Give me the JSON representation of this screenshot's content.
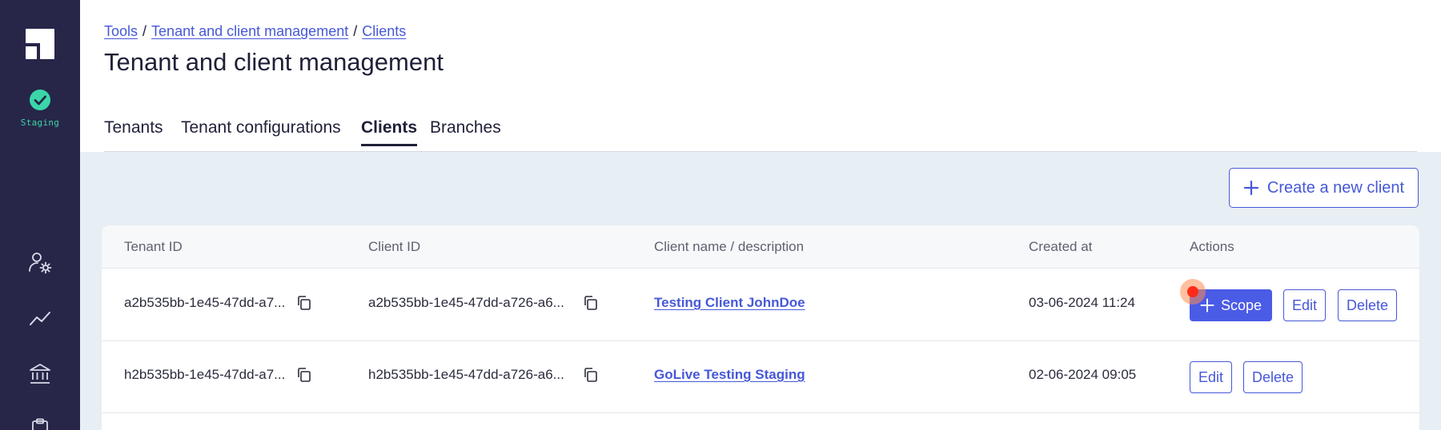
{
  "sidebar": {
    "environment_label": "Staging",
    "icons": [
      "logo-icon",
      "check-circle-icon",
      "user-settings-icon",
      "trend-chart-icon",
      "bank-icon",
      "clipboard-icon"
    ]
  },
  "breadcrumb": {
    "items": [
      "Tools",
      "Tenant and client management",
      "Clients"
    ],
    "separator": "/"
  },
  "page_title": "Tenant and client management",
  "tabs": [
    {
      "label": "Tenants",
      "active": false
    },
    {
      "label": "Tenant configurations",
      "active": false
    },
    {
      "label": "Clients",
      "active": true
    },
    {
      "label": "Branches",
      "active": false
    }
  ],
  "create_button_label": "Create a new client",
  "table": {
    "headers": [
      "Tenant ID",
      "Client ID",
      "Client name / description",
      "Created at",
      "Actions"
    ],
    "rows": [
      {
        "tenant_id": "a2b535bb-1e45-47dd-a7...",
        "client_id": "a2b535bb-1e45-47dd-a726-a6...",
        "client_name": "Testing Client JohnDoe",
        "created_at": "03-06-2024 11:24",
        "actions": {
          "scope": "Scope",
          "edit": "Edit",
          "delete": "Delete"
        }
      },
      {
        "tenant_id": "h2b535bb-1e45-47dd-a7...",
        "client_id": "h2b535bb-1e45-47dd-a726-a6...",
        "client_name": "GoLive Testing Staging",
        "created_at": "02-06-2024 09:05",
        "actions": {
          "edit": "Edit",
          "delete": "Delete"
        }
      }
    ]
  },
  "colors": {
    "sidebar_bg": "#272649",
    "accent": "#4658d8",
    "primary_button": "#4a5be6",
    "staging_green": "#3ad6a8",
    "content_bg": "#e7eef4"
  }
}
